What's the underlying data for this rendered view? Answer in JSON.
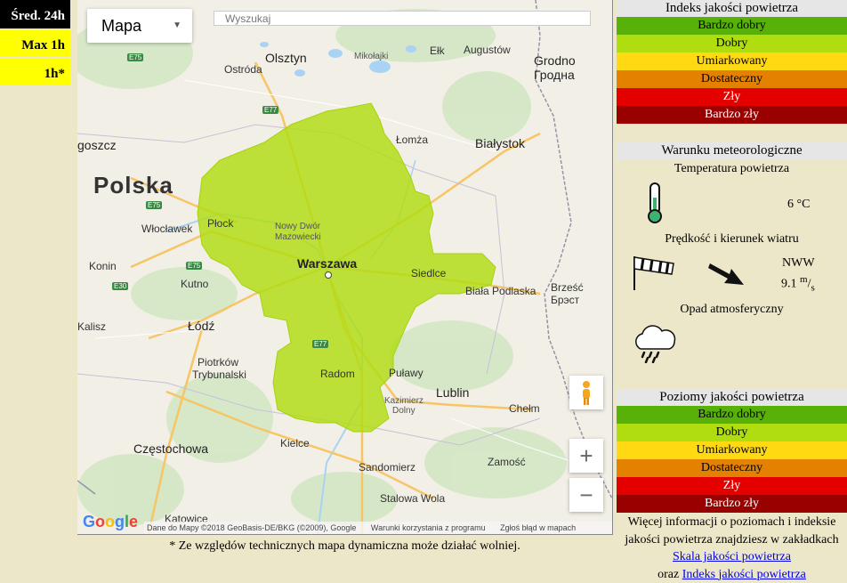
{
  "tabs": {
    "avg24": "Śred. 24h",
    "max1": "Max 1h",
    "h1": "1h*"
  },
  "map": {
    "type_label": "Mapa",
    "search_placeholder": "Wyszukaj",
    "country": "Polska",
    "labels": {
      "olsztyn": "Olsztyn",
      "ostroda": "Ostróda",
      "mikolajki": "Mikołajki",
      "elk": "Ełk",
      "augustow": "Augustów",
      "grodno": "Grodno",
      "grodno_cyr": "Гродна",
      "goszcz": "goszcz",
      "lomza": "Łomża",
      "bialystok": "Białystok",
      "plock": "Płock",
      "wloclawek": "Włocławek",
      "nowy_dwor": "Nowy Dwór",
      "mazowiecki": "Mazowiecki",
      "warszawa": "Warszawa",
      "siedlce": "Siedlce",
      "konin": "Konin",
      "kutno": "Kutno",
      "biala": "Biała Podlaska",
      "brzesc": "Brześć",
      "brest_cyr": "Брэст",
      "kalisz": "Kalisz",
      "lodz": "Łódź",
      "piotrkow": "Piotrków",
      "trybunalski": "Trybunalski",
      "radom": "Radom",
      "pulawy": "Puławy",
      "kazimierz": "Kazimierz",
      "dolny": "Dolny",
      "lublin": "Lublin",
      "chelm": "Chełm",
      "czestochowa": "Częstochowa",
      "kielce": "Kielce",
      "sandomierz": "Sandomierz",
      "zamosc": "Zamość",
      "stalowa": "Stalowa Wola",
      "katowice": "Katowice"
    },
    "roads": {
      "e75a": "E75",
      "e77a": "E77",
      "e75b": "E75",
      "e75c": "E75",
      "e30": "E30",
      "e77b": "E77"
    },
    "zoom_in": "+",
    "zoom_out": "−",
    "google_logo": "Google",
    "attribution": {
      "data": "Dane do Mapy ©2018 GeoBasis-DE/BKG (©2009), Google",
      "terms": "Warunki korzystania z programu",
      "report": "Zgłoś błąd w mapach"
    }
  },
  "footnote": "* Ze względów technicznych mapa dynamiczna może działać wolniej.",
  "index_panel": {
    "title": "Indeks jakości powietrza",
    "levels": [
      "Bardzo dobry",
      "Dobry",
      "Umiarkowany",
      "Dostateczny",
      "Zły",
      "Bardzo zły"
    ]
  },
  "meteo": {
    "title": "Warunku meteorologiczne",
    "temp_label": "Temperatura powietrza",
    "temp_value": "6 °C",
    "wind_label": "Prędkość i kierunek wiatru",
    "wind_dir": "NWW",
    "wind_speed": "9.1",
    "wind_unit_num": "m",
    "wind_unit_den": "s",
    "precip_label": "Opad atmosferyczny"
  },
  "levels_panel": {
    "title": "Poziomy jakości powietrza",
    "levels": [
      "Bardzo dobry",
      "Dobry",
      "Umiarkowany",
      "Dostateczny",
      "Zły",
      "Bardzo zły"
    ]
  },
  "info": {
    "text1": "Więcej informacji o poziomach i indeksie jakości powietrza znajdziesz w zakładkach",
    "link1": "Skala jakości powietrza",
    "text2": "oraz",
    "link2": "Indeks jakości powietrza"
  },
  "colors": {
    "very_good": "#57b108",
    "good": "#b0dd10",
    "moderate": "#ffd911",
    "sufficient": "#e58100",
    "bad": "#e50000",
    "very_bad": "#990000",
    "overlay": "#b0dd10"
  }
}
